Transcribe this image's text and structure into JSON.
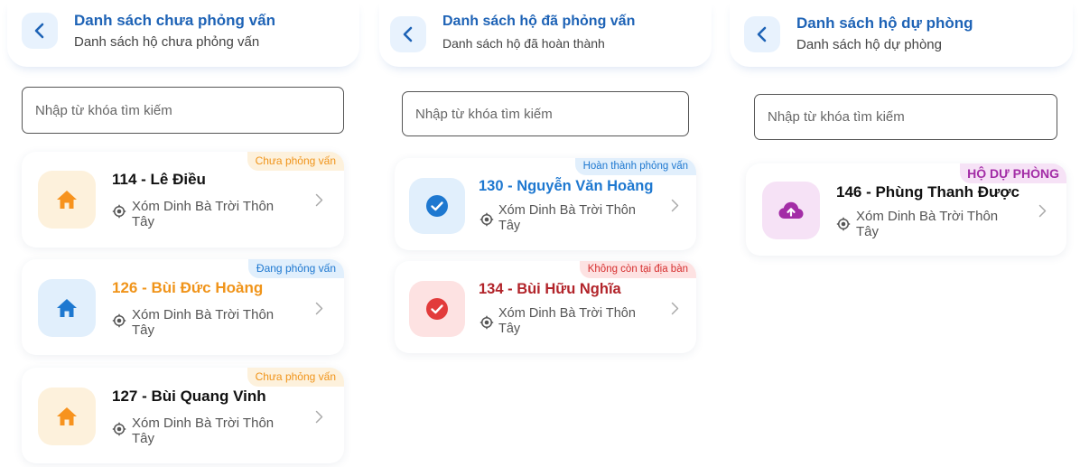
{
  "colors": {
    "accent": "#1e63b6",
    "pending_bg": "#fdf1dc",
    "pending_text": "#f0941a",
    "progress_bg": "#e1effc",
    "progress_text": "#1e78d0",
    "done_bg": "#e1effc",
    "done_text": "#1e78d0",
    "gone_bg": "#fde2e2",
    "gone_text": "#d62f2f",
    "reserve_bg": "#f6e2f6",
    "reserve_text": "#a32da6"
  },
  "panels": [
    {
      "header": {
        "title": "Danh sách chưa phỏng vấn",
        "subtitle": "Danh sách hộ chưa phỏng vấn",
        "back_icon": "chevron-left-icon"
      },
      "search": {
        "placeholder": "Nhập từ khóa tìm kiếm"
      },
      "households": [
        {
          "name": "114 - Lê Điều",
          "status": "Chưa phỏng vấn",
          "address": "Xóm Dinh Bà Trời Thôn Tây",
          "icon": "home-icon"
        },
        {
          "name": "126 - Bùi Đức Hoàng",
          "status": "Đang phỏng vấn",
          "address": "Xóm Dinh Bà Trời Thôn Tây",
          "icon": "home-icon"
        },
        {
          "name": "127 - Bùi Quang Vinh",
          "status": "Chưa phỏng vấn",
          "address": "Xóm Dinh Bà Trời Thôn Tây",
          "icon": "home-icon"
        }
      ]
    },
    {
      "header": {
        "title": "Danh sách hộ đã phỏng vấn",
        "subtitle": "Danh sách hộ đã hoàn thành",
        "back_icon": "chevron-left-icon"
      },
      "search": {
        "placeholder": "Nhập từ khóa tìm kiếm"
      },
      "households": [
        {
          "name": "130 - Nguyễn Văn Hoàng",
          "status": "Hoàn thành phỏng vấn",
          "address": "Xóm Dinh Bà Trời Thôn Tây",
          "icon": "check-circle-icon"
        },
        {
          "name": "134 - Bùi Hữu Nghĩa",
          "status": "Không còn tại địa bàn",
          "address": "Xóm Dinh Bà Trời Thôn Tây",
          "icon": "check-circle-icon"
        }
      ]
    },
    {
      "header": {
        "title": "Danh sách hộ dự phòng",
        "subtitle": "Danh sách hộ dự phòng",
        "back_icon": "chevron-left-icon"
      },
      "search": {
        "placeholder": "Nhập từ khóa tìm kiếm"
      },
      "households": [
        {
          "name": "146 - Phùng Thanh Được",
          "status": "HỘ DỰ PHÒNG",
          "address": "Xóm Dinh Bà Trời Thôn Tây",
          "icon": "cloud-upload-icon"
        }
      ]
    }
  ]
}
